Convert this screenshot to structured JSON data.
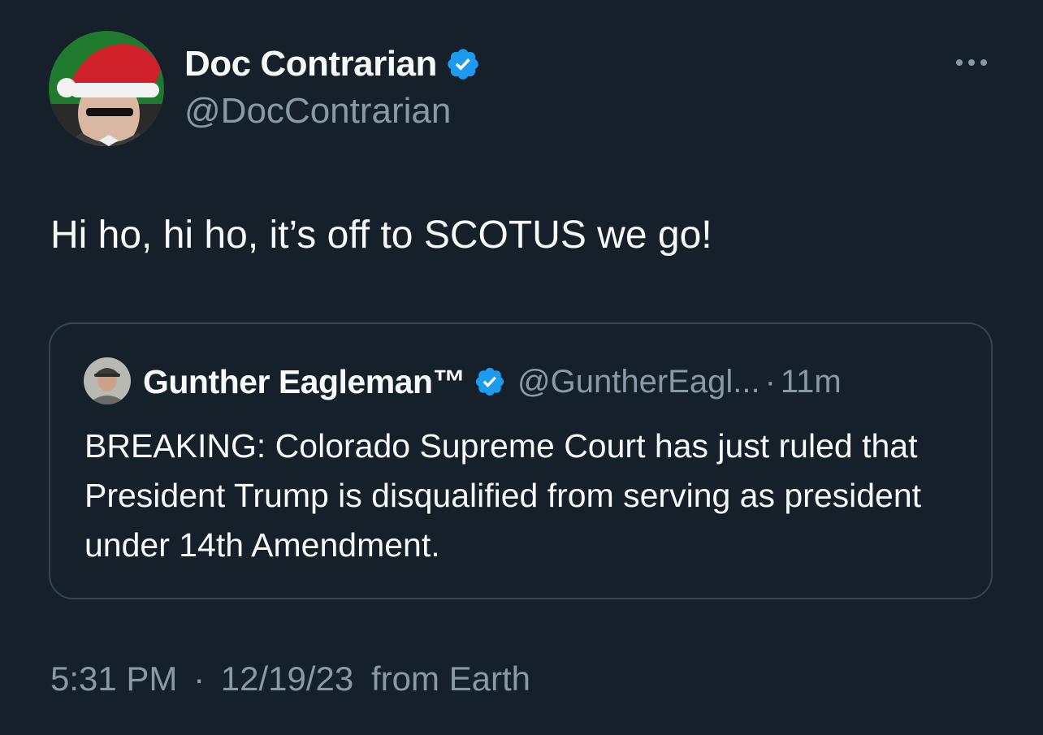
{
  "author": {
    "name": "Doc Contrarian",
    "handle": "@DocContrarian",
    "verified_color": "#1d9bf0"
  },
  "tweet": {
    "text": "Hi ho, hi ho, it’s off to SCOTUS we go!"
  },
  "quote": {
    "name": "Gunther Eagleman™",
    "handle": "@GuntherEagl...",
    "separator": "·",
    "time": "11m",
    "text": "BREAKING:  Colorado Supreme Court has just ruled that President Trump is disqualified from serving as president under 14th Amendment."
  },
  "meta": {
    "time": "5:31 PM",
    "separator": "·",
    "date": "12/19/23",
    "source": "from Earth"
  },
  "icons": {
    "more": "more-horizontal-icon",
    "verified": "verified-badge-icon"
  },
  "colors": {
    "background": "#15202b",
    "text": "#f7f9f9",
    "secondary": "#8b98a5",
    "border": "#38444d",
    "accent": "#1d9bf0"
  }
}
